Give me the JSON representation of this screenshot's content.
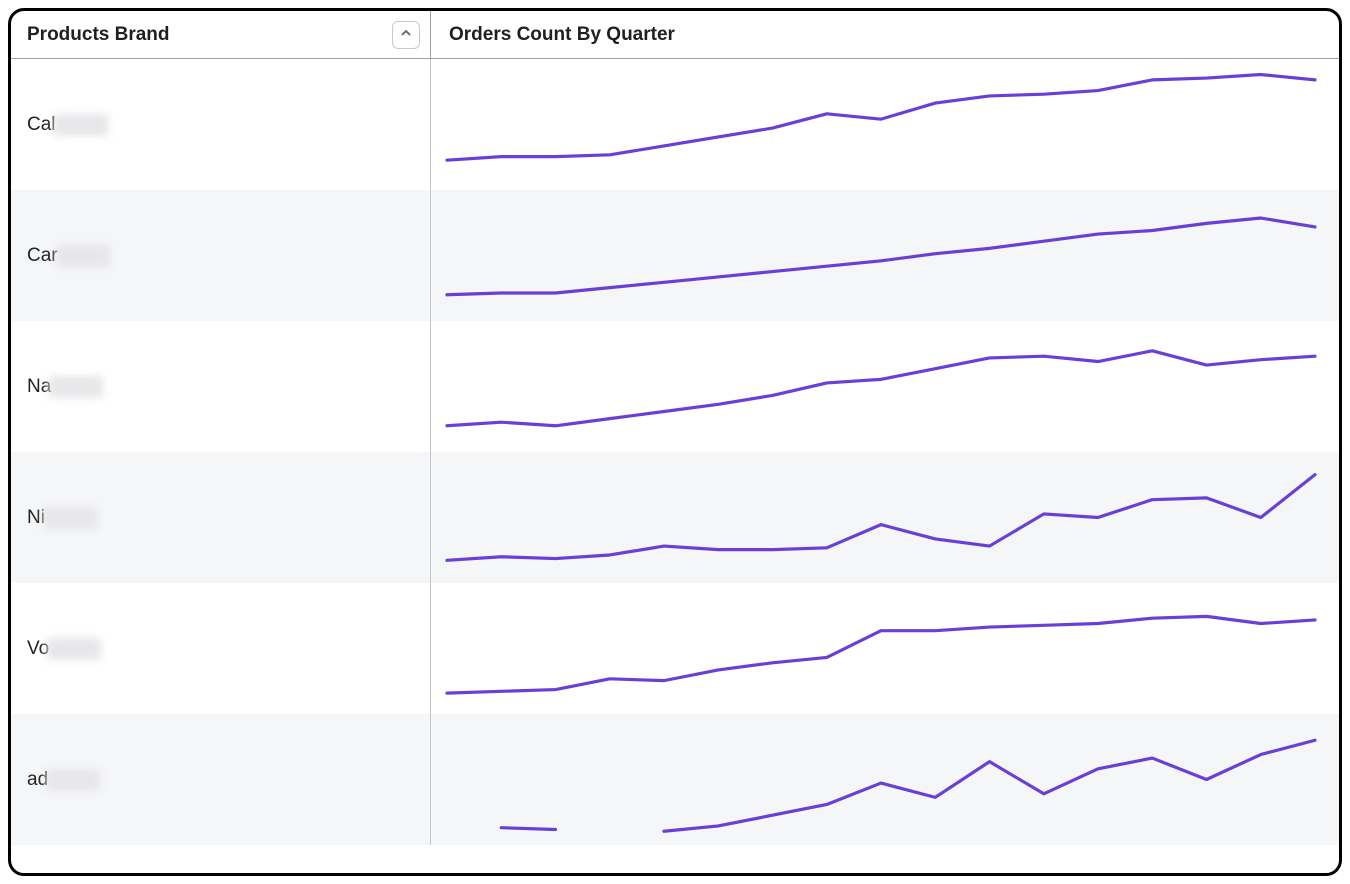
{
  "header": {
    "left_title": "Products Brand",
    "right_title": "Orders Count By Quarter"
  },
  "colors": {
    "line": "#6a3fd8",
    "alt_row_bg": "#f5f6f7"
  },
  "rows": [
    {
      "label_visible": "Cal",
      "alt": false
    },
    {
      "label_visible": "Car",
      "alt": true
    },
    {
      "label_visible": "Na",
      "alt": false
    },
    {
      "label_visible": "Ni",
      "alt": true
    },
    {
      "label_visible": "Vo",
      "alt": false
    },
    {
      "label_visible": "ad",
      "alt": true
    }
  ],
  "chart_data": [
    {
      "type": "line",
      "title": "Orders Count By Quarter — Cal…",
      "xlabel": "",
      "ylabel": "",
      "x": [
        1,
        2,
        3,
        4,
        5,
        6,
        7,
        8,
        9,
        10,
        11,
        12,
        13,
        14,
        15,
        16,
        17
      ],
      "values": [
        10,
        12,
        12,
        13,
        18,
        23,
        28,
        36,
        33,
        42,
        46,
        47,
        49,
        55,
        56,
        58,
        55
      ],
      "ylim": [
        0,
        60
      ]
    },
    {
      "type": "line",
      "title": "Orders Count By Quarter — Car…",
      "xlabel": "",
      "ylabel": "",
      "x": [
        1,
        2,
        3,
        4,
        5,
        6,
        7,
        8,
        9,
        10,
        11,
        12,
        13,
        14,
        15,
        16,
        17
      ],
      "values": [
        8,
        9,
        9,
        12,
        15,
        18,
        21,
        24,
        27,
        31,
        34,
        38,
        42,
        44,
        48,
        51,
        46
      ],
      "ylim": [
        0,
        60
      ]
    },
    {
      "type": "line",
      "title": "Orders Count By Quarter — Na…",
      "xlabel": "",
      "ylabel": "",
      "x": [
        1,
        2,
        3,
        4,
        5,
        6,
        7,
        8,
        9,
        10,
        11,
        12,
        13,
        14,
        15,
        16,
        17
      ],
      "values": [
        8,
        10,
        8,
        12,
        16,
        20,
        25,
        32,
        34,
        40,
        46,
        47,
        44,
        50,
        42,
        45,
        47
      ],
      "ylim": [
        0,
        60
      ]
    },
    {
      "type": "line",
      "title": "Orders Count By Quarter — Ni…",
      "xlabel": "",
      "ylabel": "",
      "x": [
        1,
        2,
        3,
        4,
        5,
        6,
        7,
        8,
        9,
        10,
        11,
        12,
        13,
        14,
        15,
        16,
        17
      ],
      "values": [
        6,
        8,
        7,
        9,
        14,
        12,
        12,
        13,
        26,
        18,
        14,
        32,
        30,
        40,
        41,
        30,
        54
      ],
      "ylim": [
        0,
        60
      ]
    },
    {
      "type": "line",
      "title": "Orders Count By Quarter — Vo…",
      "xlabel": "",
      "ylabel": "",
      "x": [
        1,
        2,
        3,
        4,
        5,
        6,
        7,
        8,
        9,
        10,
        11,
        12,
        13,
        14,
        15,
        16,
        17
      ],
      "values": [
        5,
        6,
        7,
        13,
        12,
        18,
        22,
        25,
        40,
        40,
        42,
        43,
        44,
        47,
        48,
        44,
        46
      ],
      "ylim": [
        0,
        60
      ]
    },
    {
      "type": "line",
      "title": "Orders Count By Quarter — ad…",
      "xlabel": "",
      "ylabel": "",
      "x": [
        1,
        2,
        3,
        4,
        5,
        6,
        7,
        8,
        9,
        10,
        11,
        12,
        13,
        14,
        15,
        16,
        17
      ],
      "values": [
        null,
        3,
        2,
        null,
        1,
        4,
        10,
        16,
        28,
        20,
        40,
        22,
        36,
        42,
        30,
        44,
        52
      ],
      "ylim": [
        0,
        60
      ]
    }
  ]
}
